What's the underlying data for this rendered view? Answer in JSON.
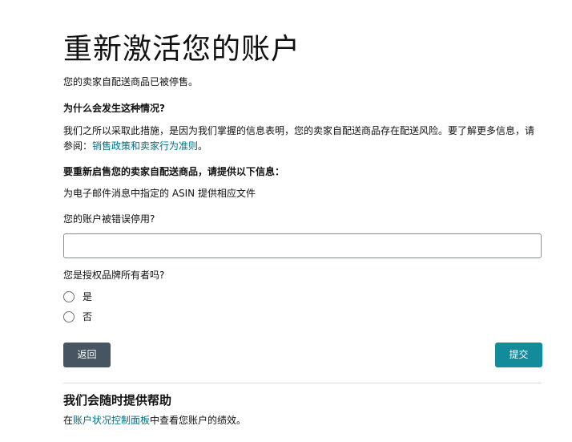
{
  "page": {
    "title": "重新激活您的账户",
    "subtitle": "您的卖家自配送商品已被停售。"
  },
  "why": {
    "heading": "为什么会发生这种情况?",
    "text": "我们之所以采取此措施，是因为我们掌握的信息表明，您的卖家自配送商品存在配送风险。要了解更多信息，请参阅：",
    "link": "销售政策和卖家行为准则",
    "text_end": "。"
  },
  "requirements": {
    "heading": "要重新启售您的卖家自配送商品，请提供以下信息：",
    "item": "为电子邮件消息中指定的 ASIN 提供相应文件"
  },
  "question1": {
    "label": "您的账户被错误停用?",
    "value": "",
    "placeholder": ""
  },
  "question2": {
    "label": "您是授权品牌所有者吗?",
    "options": [
      {
        "label": "是",
        "selected": false
      },
      {
        "label": "否",
        "selected": false
      }
    ]
  },
  "buttons": {
    "back": "返回",
    "submit": "提交"
  },
  "help": {
    "heading": "我们会随时提供帮助",
    "text_start": "在",
    "link": "账户状况控制面板",
    "text_end": "中查看您账户的绩效。"
  },
  "colors": {
    "link": "#007185",
    "back_button": "#475462",
    "submit_button": "#138b9b",
    "text": "#111111"
  }
}
